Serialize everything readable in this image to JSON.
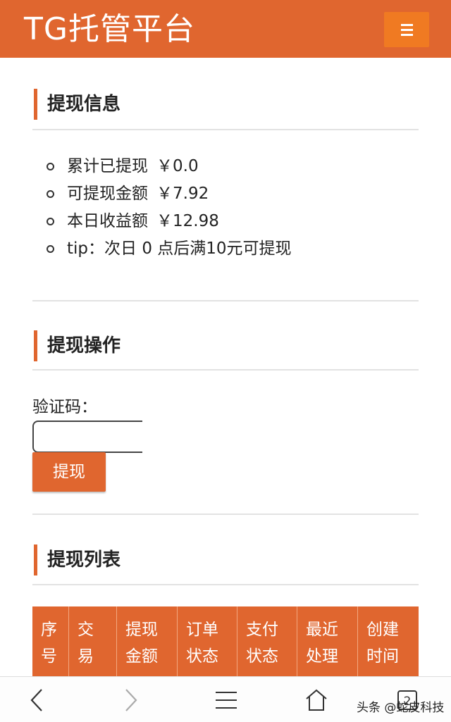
{
  "header": {
    "logo": "TG托管平台",
    "menu_icon": "hamburger-menu-icon",
    "brand_color": "#e0662f"
  },
  "withdraw_info": {
    "title": "提现信息",
    "items": [
      {
        "label": "累计已提现",
        "value": "￥0.0"
      },
      {
        "label": "可提现金额",
        "value": "￥7.92"
      },
      {
        "label": "本日收益额",
        "value": "￥12.98"
      },
      {
        "label": "tip：次日 0 点后满10元可提现",
        "value": ""
      }
    ]
  },
  "withdraw_action": {
    "title": "提现操作",
    "captcha_label": "验证码：",
    "captcha_value": "",
    "submit_label": "提现"
  },
  "withdraw_list": {
    "title": "提现列表",
    "columns": [
      [
        "序",
        "号"
      ],
      [
        "交",
        "易"
      ],
      [
        "提现",
        "金额"
      ],
      [
        "订单",
        "状态"
      ],
      [
        "支付",
        "状态"
      ],
      [
        "最近",
        "处理"
      ],
      [
        "创建",
        "时间"
      ]
    ]
  },
  "browser_nav": {
    "icons": [
      "back-icon",
      "forward-icon",
      "menu-lines-icon",
      "home-icon",
      "tabs-icon"
    ],
    "tab_count": "2"
  },
  "watermark": "头条 @蛇皮科技"
}
